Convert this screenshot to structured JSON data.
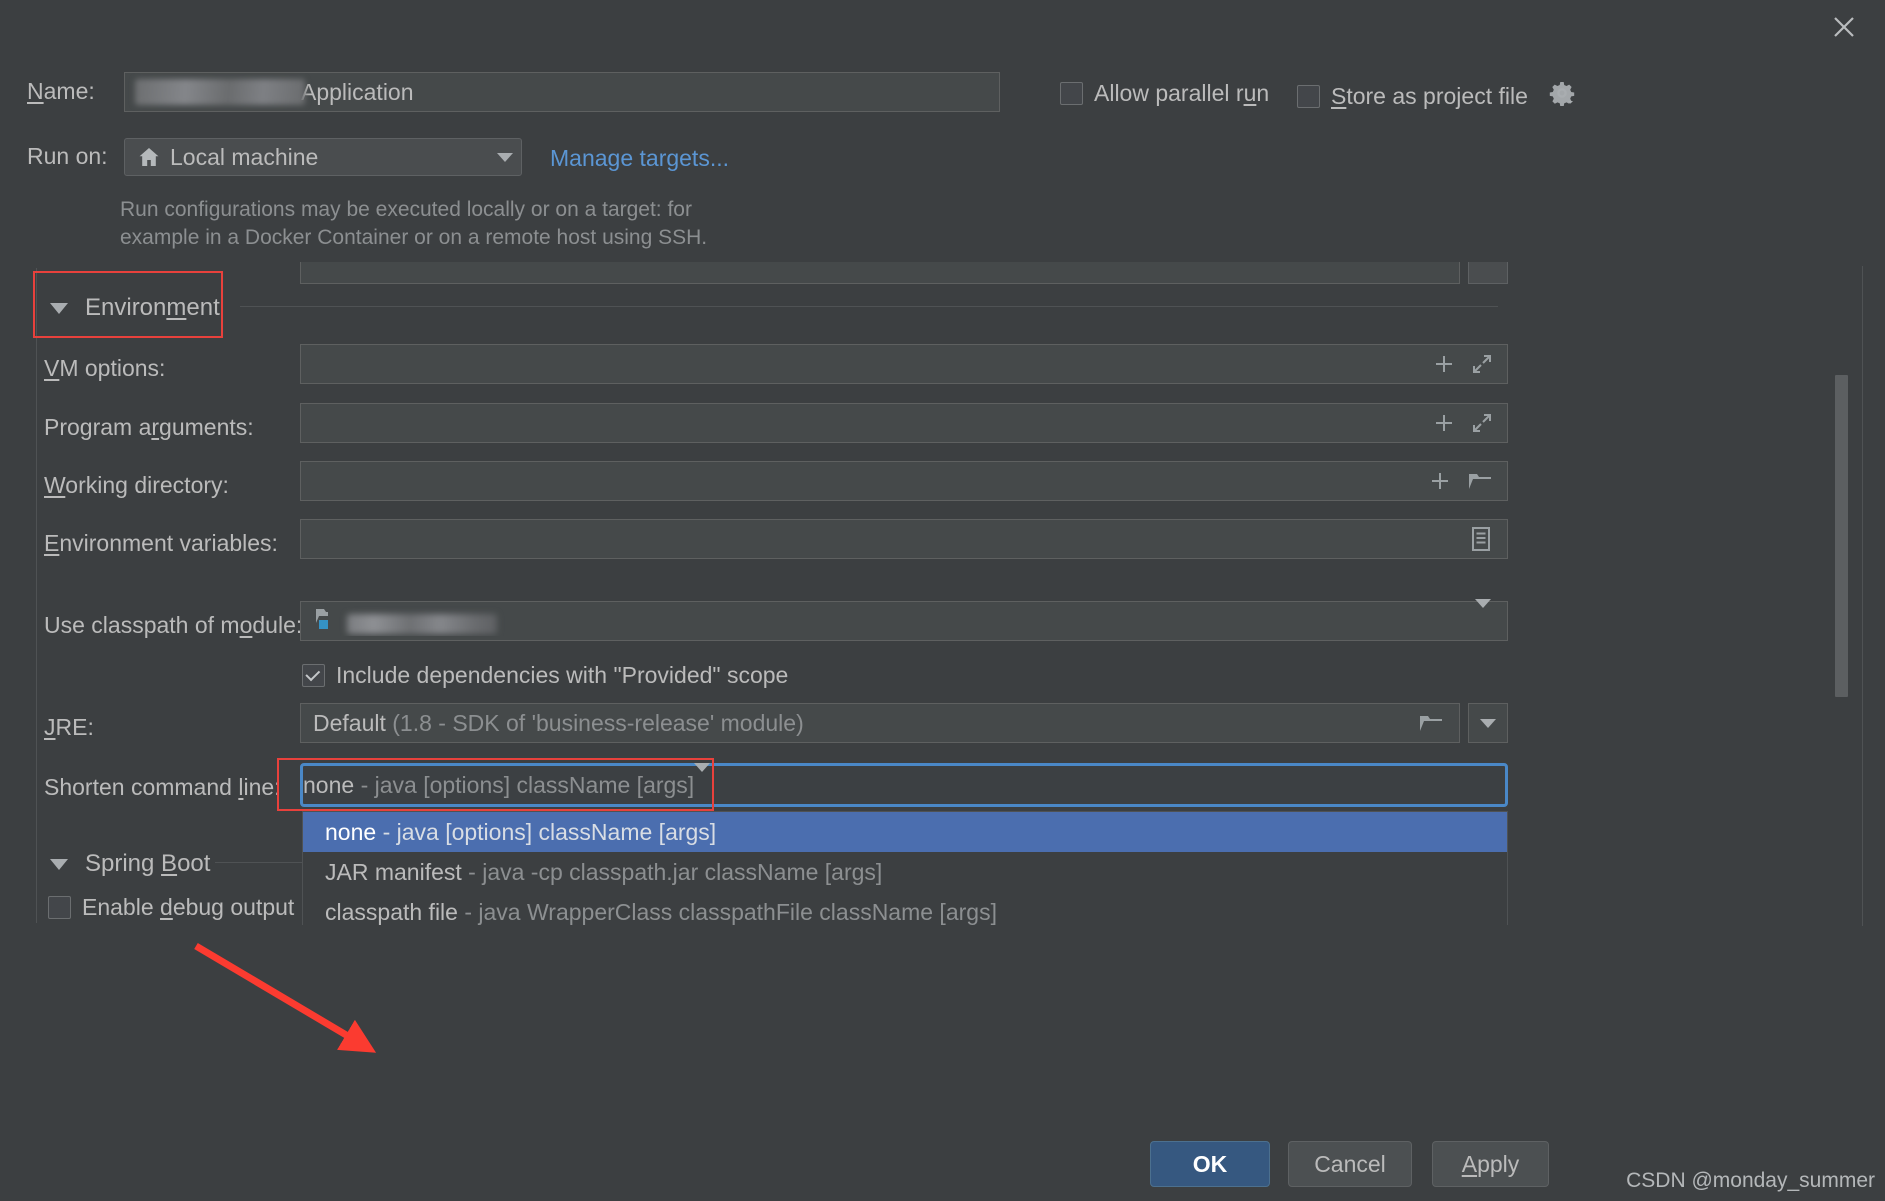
{
  "dialog": {
    "close_icon": "close-icon"
  },
  "header": {
    "name_label": "Name:",
    "name_value_suffix": "Application",
    "name_value_redacted": true,
    "run_on_label": "Run on:",
    "run_on_value": "Local machine",
    "run_on_icon": "home-icon",
    "manage_targets_link": "Manage targets...",
    "hint_line1": "Run configurations may be executed locally or on a target: for",
    "hint_line2": "example in a Docker Container or on a remote host using SSH.",
    "allow_parallel_run": {
      "label": "Allow parallel run",
      "checked": false
    },
    "store_as_project_file": {
      "label": "Store as project file",
      "checked": false,
      "icon": "gear-icon"
    }
  },
  "environment": {
    "section_title": "Environment",
    "expanded": true,
    "fields": [
      {
        "label": "VM options:",
        "value": "",
        "icons": [
          "plus-icon",
          "expand-icon"
        ]
      },
      {
        "label": "Program arguments:",
        "value": "",
        "icons": [
          "plus-icon",
          "expand-icon"
        ]
      },
      {
        "label": "Working directory:",
        "value": "",
        "icons": [
          "plus-icon",
          "folder-icon"
        ]
      },
      {
        "label": "Environment variables:",
        "value": "",
        "icons": [
          "list-icon"
        ]
      }
    ],
    "module": {
      "label": "Use classpath of module:",
      "value_redacted": true,
      "icon": "module-icon",
      "arrow_icon": "chevron-down-icon"
    },
    "include_provided": {
      "label": "Include dependencies with \"Provided\" scope",
      "checked": true
    },
    "jre": {
      "label": "JRE:",
      "value_bold": "Default",
      "value_dim": "(1.8 - SDK of 'business-release' module)",
      "folder_icon": "folder-icon",
      "arrow_icon": "chevron-down-icon"
    },
    "shorten": {
      "label": "Shorten command line:",
      "selected_bold": "none",
      "selected_dim": "- java [options] className [args]",
      "arrow_icon": "chevron-down-icon",
      "options": [
        {
          "bold": "none",
          "dim": "- java [options] className [args]",
          "selected": true
        },
        {
          "bold": "JAR manifest",
          "dim": "- java -cp classpath.jar className [args]",
          "selected": false
        },
        {
          "bold": "classpath file",
          "dim": "- java WrapperClass classpathFile className [args]",
          "selected": false
        }
      ]
    }
  },
  "spring_boot": {
    "section_title": "Spring Boot",
    "expanded": true,
    "enable_debug_output": {
      "label": "Enable debug output",
      "checked": false
    }
  },
  "footer": {
    "ok_label": "OK",
    "cancel_label": "Cancel",
    "apply_label": "Apply",
    "watermark": "CSDN @monday_summer"
  },
  "colors": {
    "background": "#3c3f41",
    "field_bg": "#45494a",
    "accent_link": "#5b96d4",
    "selection": "#4b6eaf",
    "ok_button": "#365880",
    "annotation_red": "#e8413c",
    "focus_border": "#4a88c7"
  }
}
